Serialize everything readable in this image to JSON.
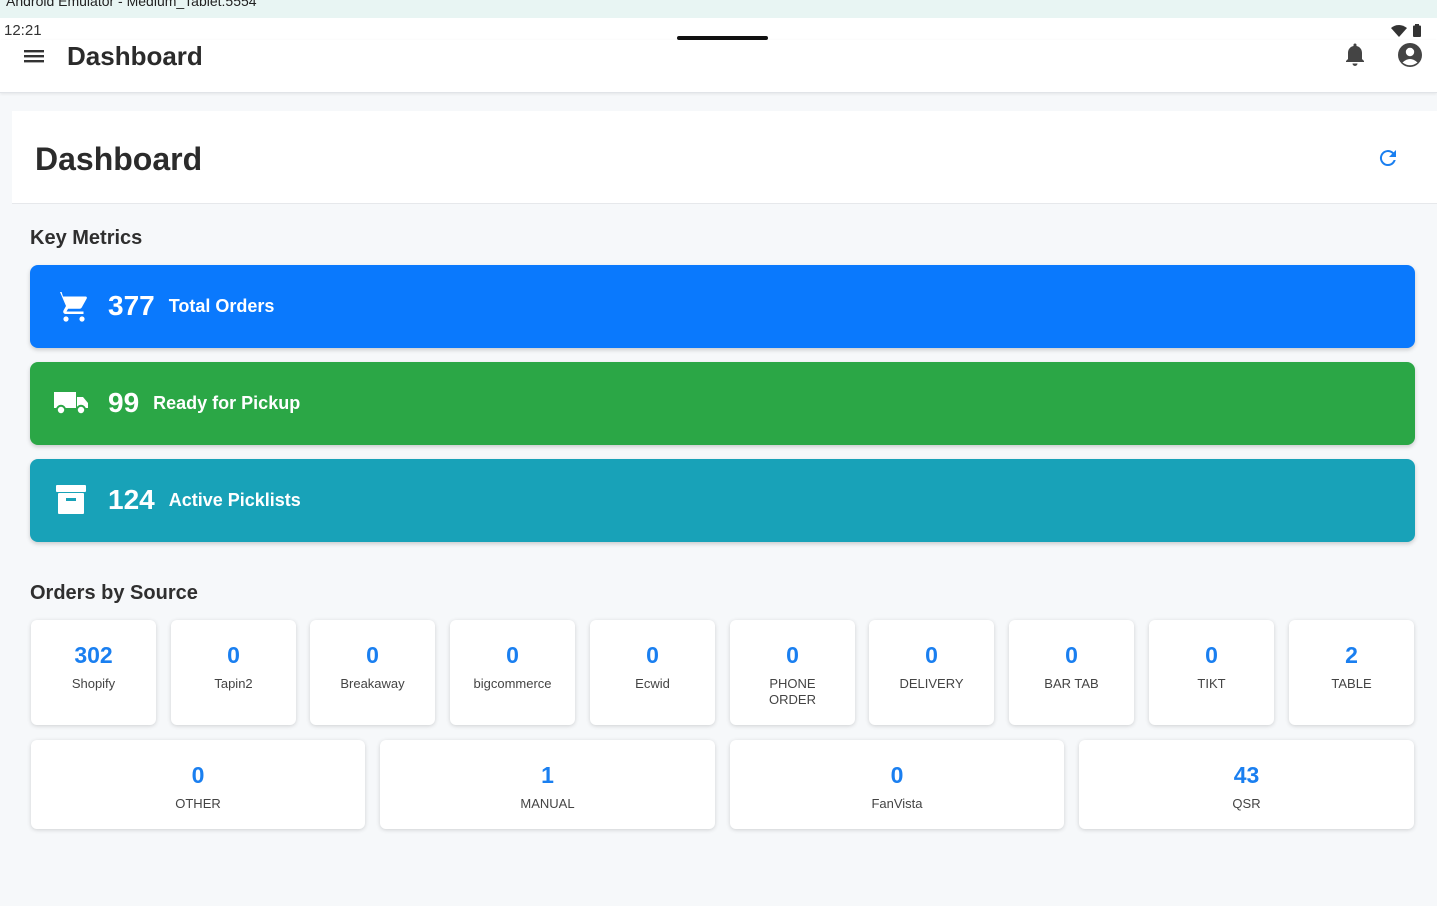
{
  "window": {
    "title": "Android Emulator - Medium_Tablet:5554"
  },
  "status_bar": {
    "time": "12:21"
  },
  "app_bar": {
    "title": "Dashboard",
    "menu_icon": "hamburger-menu-icon",
    "notification_icon": "bell-icon",
    "account_icon": "account-circle-icon"
  },
  "page": {
    "title": "Dashboard",
    "refresh_icon": "refresh-icon"
  },
  "key_metrics": {
    "title": "Key Metrics",
    "items": [
      {
        "value": "377",
        "label": "Total Orders",
        "icon": "cart-icon",
        "color": "#0a79fd"
      },
      {
        "value": "99",
        "label": "Ready for Pickup",
        "icon": "truck-icon",
        "color": "#2ba746"
      },
      {
        "value": "124",
        "label": "Active Picklists",
        "icon": "archive-icon",
        "color": "#18a2b8"
      }
    ]
  },
  "orders_by_source": {
    "title": "Orders by Source",
    "sources": [
      {
        "count": "302",
        "label": "Shopify"
      },
      {
        "count": "0",
        "label": "Tapin2"
      },
      {
        "count": "0",
        "label": "Breakaway"
      },
      {
        "count": "0",
        "label": "bigcommerce"
      },
      {
        "count": "0",
        "label": "Ecwid"
      },
      {
        "count": "0",
        "label": "PHONE ORDER"
      },
      {
        "count": "0",
        "label": "DELIVERY"
      },
      {
        "count": "0",
        "label": "BAR TAB"
      },
      {
        "count": "0",
        "label": "TIKT"
      },
      {
        "count": "2",
        "label": "TABLE"
      },
      {
        "count": "0",
        "label": "OTHER"
      },
      {
        "count": "1",
        "label": "MANUAL"
      },
      {
        "count": "0",
        "label": "FanVista"
      },
      {
        "count": "43",
        "label": "QSR"
      }
    ]
  },
  "colors": {
    "accent": "#1a7ff0",
    "background": "#f6f8fa"
  }
}
